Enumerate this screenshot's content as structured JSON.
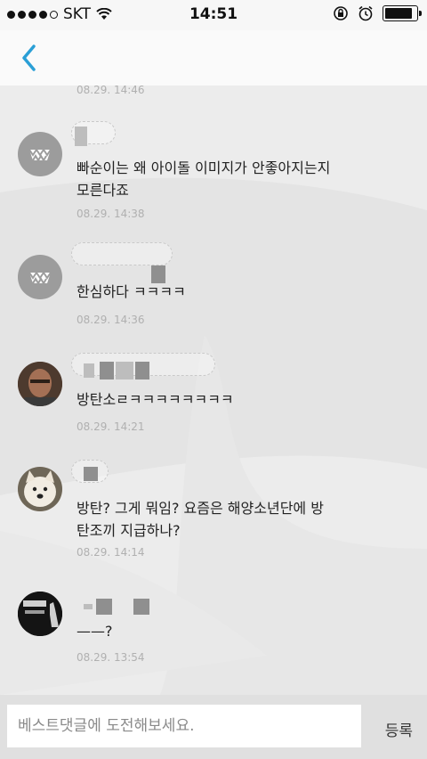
{
  "status_bar": {
    "carrier": "SKT",
    "time": "14:51",
    "signal_icon": "signal-dots-icon",
    "wifi_icon": "wifi-icon",
    "battery_level": 0.9
  },
  "nav": {
    "back_icon": "chevron-left-icon",
    "accent_color": "#2a9fd6"
  },
  "comments": {
    "top_timestamp": "08.29. 14:46",
    "items": [
      {
        "avatar_icon": "grin-face-icon",
        "text_lines": [
          "빠순이는 왜 아이돌 이미지가 안좋아지는지",
          "모른다죠"
        ],
        "timestamp": "08.29. 14:38"
      },
      {
        "avatar_icon": "grin-face-icon",
        "text_lines": [
          "한심하다 ㅋㅋㅋㅋ"
        ],
        "timestamp": "08.29. 14:36"
      },
      {
        "avatar_icon": "user-photo-icon",
        "text_lines": [
          "방탄소ㄹㅋㅋㅋㅋㅋㅋㅋㅋ"
        ],
        "timestamp": "08.29. 14:21"
      },
      {
        "avatar_icon": "dog-photo-icon",
        "text_lines": [
          "방탄? 그게 뭐임? 요즘은 해양소년단에 방",
          "탄조끼 지급하나?"
        ],
        "timestamp": "08.29. 14:14"
      },
      {
        "avatar_icon": "poster-photo-icon",
        "text_lines": [
          "——?"
        ],
        "timestamp": "08.29. 13:54"
      }
    ]
  },
  "compose": {
    "placeholder": "베스트댓글에 도전해보세요.",
    "submit_label": "등록"
  }
}
